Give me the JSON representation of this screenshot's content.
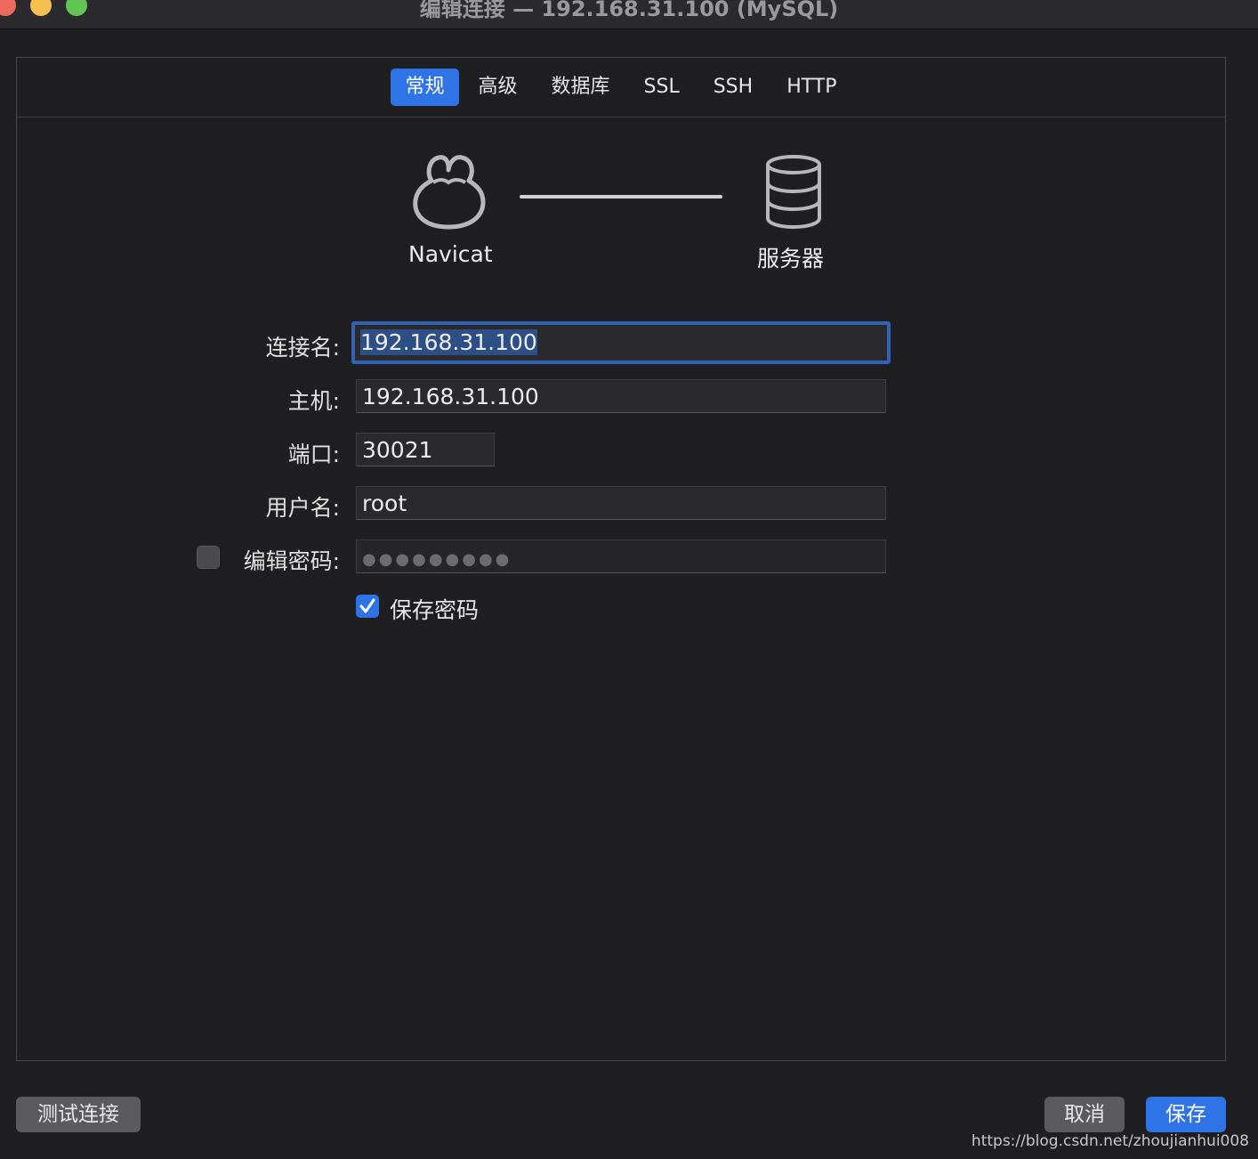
{
  "window": {
    "title": "编辑连接 — 192.168.31.100 (MySQL)"
  },
  "tabs": [
    {
      "label": "常规",
      "active": true
    },
    {
      "label": "高级",
      "active": false
    },
    {
      "label": "数据库",
      "active": false
    },
    {
      "label": "SSL",
      "active": false
    },
    {
      "label": "SSH",
      "active": false
    },
    {
      "label": "HTTP",
      "active": false
    }
  ],
  "diagram": {
    "client_label": "Navicat",
    "server_label": "服务器",
    "client_icon": "navicat-logo-icon",
    "server_icon": "database-icon"
  },
  "form": {
    "connection_name_label": "连接名:",
    "connection_name_value": "192.168.31.100",
    "host_label": "主机:",
    "host_value": "192.168.31.100",
    "port_label": "端口:",
    "port_value": "30021",
    "username_label": "用户名:",
    "username_value": "root",
    "edit_password_label": "编辑密码:",
    "edit_password_checked": false,
    "password_mask": "●●●●●●●●●",
    "save_password_label": "保存密码",
    "save_password_checked": true
  },
  "buttons": {
    "test_connection": "测试连接",
    "cancel": "取消",
    "save": "保存"
  },
  "watermark": "https://blog.csdn.net/zhoujianhui008",
  "colors": {
    "accent": "#2f74e6",
    "background": "#1f1f21"
  }
}
